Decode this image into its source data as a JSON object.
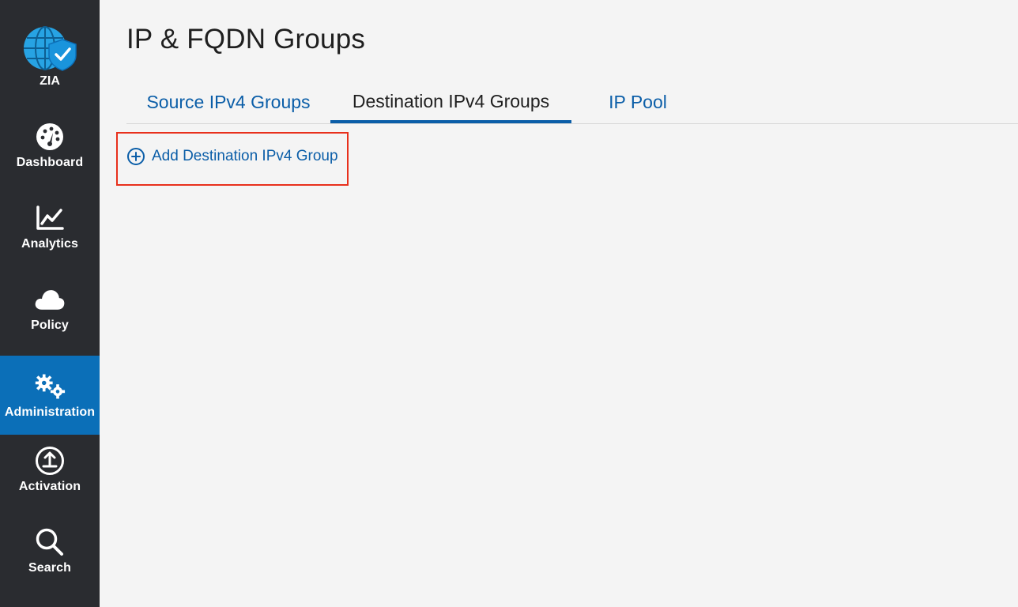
{
  "sidebar": {
    "logo_label": "ZIA",
    "items": [
      {
        "label": "Dashboard",
        "icon": "dashboard-icon"
      },
      {
        "label": "Analytics",
        "icon": "analytics-icon"
      },
      {
        "label": "Policy",
        "icon": "cloud-icon"
      },
      {
        "label": "Administration",
        "icon": "gears-icon",
        "active": true
      },
      {
        "label": "Activation",
        "icon": "upload-icon"
      },
      {
        "label": "Search",
        "icon": "search-icon"
      }
    ]
  },
  "page": {
    "title": "IP & FQDN Groups"
  },
  "tabs": [
    {
      "label": "Source IPv4 Groups"
    },
    {
      "label": "Destination IPv4 Groups",
      "active": true
    },
    {
      "label": "IP Pool"
    }
  ],
  "actions": {
    "add_label": "Add Destination IPv4 Group"
  },
  "colors": {
    "sidebar": "#2a2c30",
    "active_nav": "#0b6fb8",
    "link": "#0b5ea8",
    "highlight": "#e8301c"
  }
}
